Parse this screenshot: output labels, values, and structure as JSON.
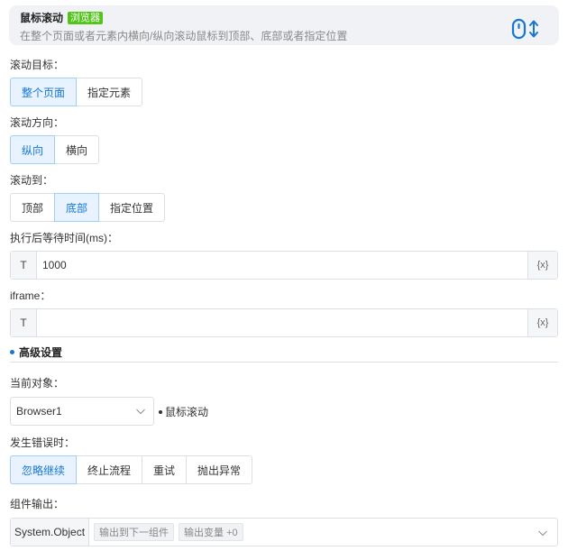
{
  "header": {
    "title": "鼠标滚动",
    "badge": "浏览器",
    "description": "在整个页面或者元素内横向/纵向滚动鼠标到顶部、底部或者指定位置",
    "icon": "mouse-scroll-icon"
  },
  "scroll_target": {
    "label": "滚动目标：",
    "options": [
      "整个页面",
      "指定元素"
    ],
    "selected": "整个页面"
  },
  "scroll_direction": {
    "label": "滚动方向：",
    "options": [
      "纵向",
      "横向"
    ],
    "selected": "纵向"
  },
  "scroll_to": {
    "label": "滚动到：",
    "options": [
      "顶部",
      "底部",
      "指定位置"
    ],
    "selected": "底部"
  },
  "wait_time": {
    "label": "执行后等待时间(ms)：",
    "prefix": "T",
    "value": "1000",
    "suffix": "{x}"
  },
  "iframe": {
    "label": "iframe：",
    "prefix": "T",
    "value": "",
    "suffix": "{x}"
  },
  "advanced": {
    "title": "高级设置"
  },
  "current_object": {
    "label": "当前对象：",
    "value": "Browser1",
    "side_text": "鼠标滚动"
  },
  "on_error": {
    "label": "发生错误时：",
    "options": [
      "忽略继续",
      "终止流程",
      "重试",
      "抛出异常"
    ],
    "selected": "忽略继续"
  },
  "output": {
    "label": "组件输出：",
    "type": "System.Object",
    "tags": [
      "输出到下一组件",
      "输出变量 +0"
    ]
  },
  "colors": {
    "accent": "#1677d2",
    "badge_green": "#52c41a"
  }
}
